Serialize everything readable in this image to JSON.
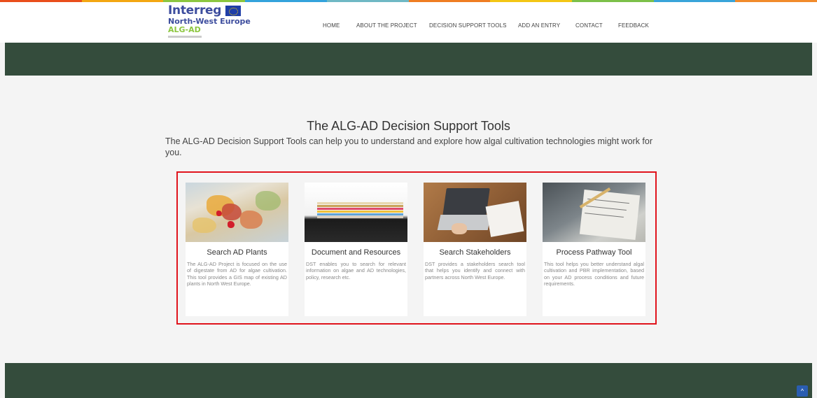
{
  "colors": {
    "header_band": "#344c3c",
    "highlight_border": "#e0141c",
    "brand_blue": "#3d4d9e",
    "brand_green": "#8cc63f",
    "stripe": [
      "#e94e1b",
      "#f3a712",
      "#8cc63f",
      "#33a3dc",
      "#6fb8c4",
      "#ef7d22",
      "#f3c614",
      "#7cc049",
      "#39a4d9",
      "#f18b2b"
    ]
  },
  "logo": {
    "brand": "Interreg",
    "region": "North-West Europe",
    "project": "ALG-AD"
  },
  "nav": {
    "items": [
      "HOME",
      "ABOUT THE PROJECT",
      "DECISION SUPPORT TOOLS",
      "ADD AN ENTRY",
      "CONTACT",
      "FEEDBACK"
    ]
  },
  "main": {
    "title": "The ALG-AD Decision Support Tools",
    "intro": "The ALG-AD Decision Support Tools can help you to understand and explore how algal cultivation technologies might work for you."
  },
  "cards": [
    {
      "title": "Search AD Plants",
      "description": "The ALG-AD Project is focused on the use of digestate from AD for algae cultivation. This tool provides a GIS map of existing AD plants in North West Europe.",
      "image": "europe-map-image"
    },
    {
      "title": "Document and Resources",
      "description": "DST enables you to search for relevant information on algae and AD technologies, policy, research etc.",
      "image": "document-stack-image"
    },
    {
      "title": "Search Stakeholders",
      "description": "DST provides a stakeholders search tool that helps you identify and connect with partners across North West Europe.",
      "image": "laptop-image"
    },
    {
      "title": "Process Pathway Tool",
      "description": "This tool helps you better understand algal cultivation and PBR implementation, based on your AD process conditions and future requirements.",
      "image": "notebook-image"
    }
  ],
  "scroll_top": {
    "icon": "chevron-up-icon",
    "glyph": "^"
  }
}
